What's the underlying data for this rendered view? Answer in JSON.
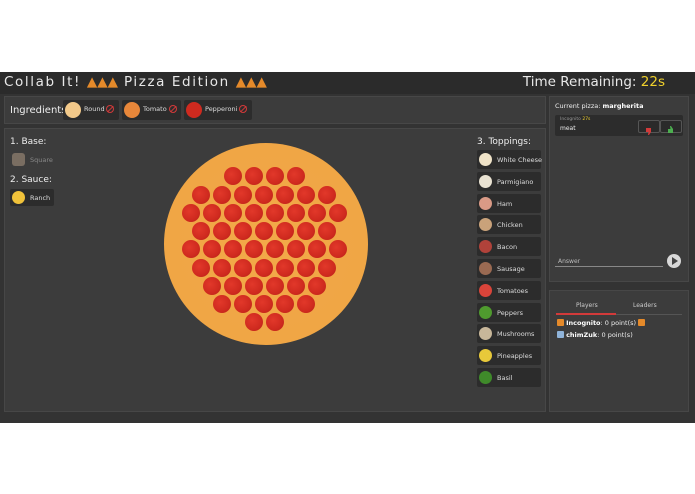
{
  "header": {
    "title": "Collab It!",
    "subtitle": "Pizza Edition",
    "timer_label": "Time Remaining:",
    "timer_value": "22s"
  },
  "ingredients_bar": {
    "label": "Ingredients:",
    "items": [
      {
        "label": "Round",
        "icon": "round-dough-icon",
        "color": "#f2c98a"
      },
      {
        "label": "Tomato",
        "icon": "tomato-sauce-icon",
        "color": "#e8873a"
      },
      {
        "label": "Pepperoni",
        "icon": "pepperoni-icon",
        "color": "#cf2a1f"
      }
    ]
  },
  "base": {
    "heading": "1. Base:",
    "options": [
      {
        "label": "Square",
        "icon": "square-dough-icon",
        "state": "disabled"
      }
    ]
  },
  "sauce": {
    "heading": "2. Sauce:",
    "options": [
      {
        "label": "Ranch",
        "icon": "ranch-sauce-icon",
        "color": "#f0c23a"
      }
    ]
  },
  "toppings": {
    "heading": "3. Toppings:",
    "items": [
      {
        "label": "White Cheese",
        "icon": "white-cheese-icon",
        "color": "#efe3c8"
      },
      {
        "label": "Parmigiano",
        "icon": "parmigiano-icon",
        "color": "#e9e2d2"
      },
      {
        "label": "Ham",
        "icon": "ham-icon",
        "color": "#d99a86"
      },
      {
        "label": "Chicken",
        "icon": "chicken-icon",
        "color": "#c9a27a"
      },
      {
        "label": "Bacon",
        "icon": "bacon-icon",
        "color": "#b0423a"
      },
      {
        "label": "Sausage",
        "icon": "sausage-icon",
        "color": "#9a6a52"
      },
      {
        "label": "Tomatoes",
        "icon": "tomatoes-icon",
        "color": "#d9443a"
      },
      {
        "label": "Peppers",
        "icon": "peppers-icon",
        "color": "#4f9a2e"
      },
      {
        "label": "Mushrooms",
        "icon": "mushrooms-icon",
        "color": "#c8b79a"
      },
      {
        "label": "Pineapples",
        "icon": "pineapples-icon",
        "color": "#e8c93a"
      },
      {
        "label": "Basil",
        "icon": "basil-icon",
        "color": "#3f8a2a"
      }
    ]
  },
  "chat": {
    "current_label": "Current pizza:",
    "current_value": "margherita",
    "message": {
      "author": "Incognito",
      "time": "27s",
      "text": "meat"
    },
    "answer_placeholder": "Answer"
  },
  "leaderboard": {
    "tabs": [
      "Players",
      "Leaders"
    ],
    "active_tab": "Players",
    "players": [
      {
        "name": "Incognito",
        "points": ": 0 point(s)",
        "color": "#e58a2a"
      },
      {
        "name": "chimZuk",
        "points": ": 0 point(s)",
        "color": "#8fb3d9"
      }
    ]
  },
  "colors": {
    "accent": "#f0d12c",
    "slice": "#e58a2a",
    "danger": "#d23a3a",
    "like": "#4caf50"
  }
}
